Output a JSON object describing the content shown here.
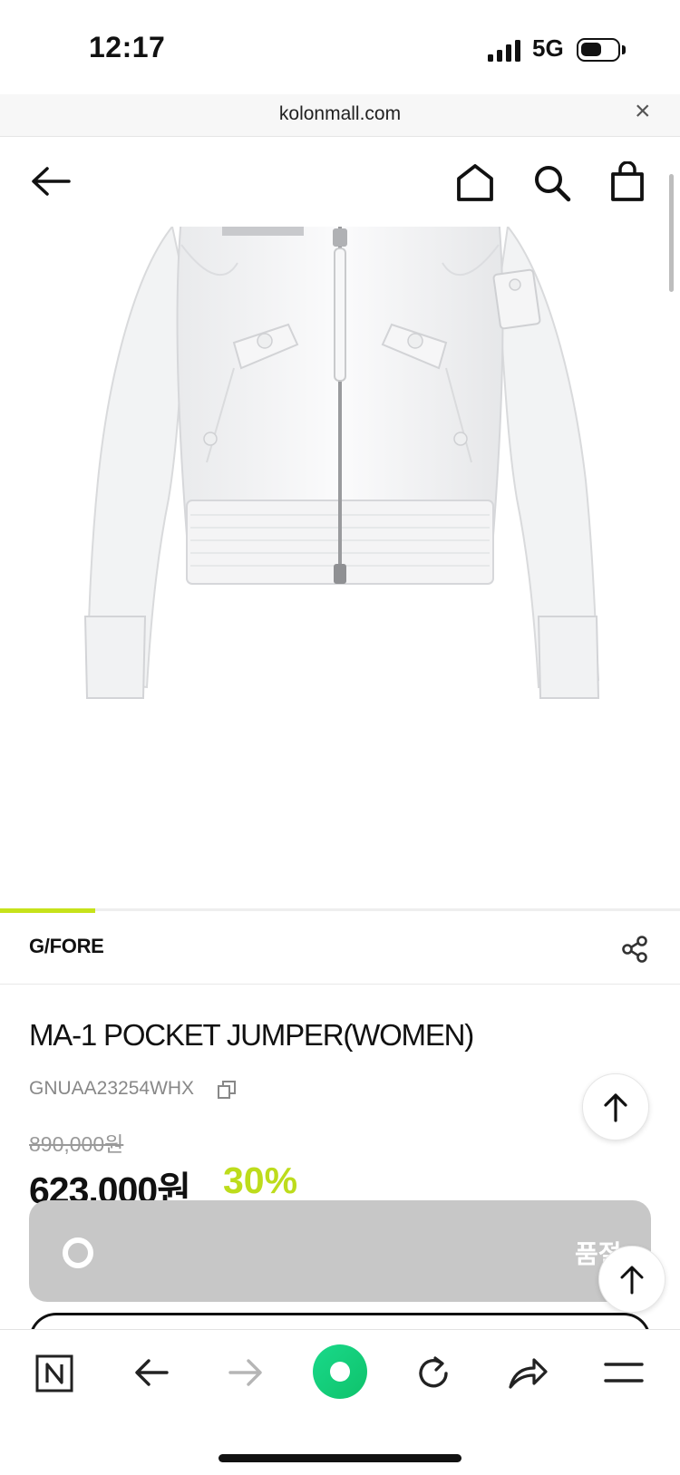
{
  "status_bar": {
    "time": "12:17",
    "network": "5G"
  },
  "browser": {
    "url": "kolonmall.com",
    "close_label": "×"
  },
  "header": {
    "icons": [
      "back-arrow-icon",
      "home-icon",
      "search-icon",
      "shopping-bag-icon"
    ]
  },
  "gallery": {
    "progress": 0.14,
    "accent_color": "#c6e21a"
  },
  "product": {
    "brand": "G/FORE",
    "title": "MA-1 POCKET JUMPER(WOMEN)",
    "code": "GNUAA23254WHX",
    "original_price": "890,000원",
    "sale_price": "623,000원",
    "discount": "30%",
    "discount_color": "#bddc1c"
  },
  "purchase": {
    "soldout_label": "품절"
  },
  "toolbar": {
    "icons": [
      "naver-n-icon",
      "back-icon",
      "forward-icon",
      "green-dot-icon",
      "refresh-icon",
      "share-icon",
      "menu-icon"
    ]
  }
}
